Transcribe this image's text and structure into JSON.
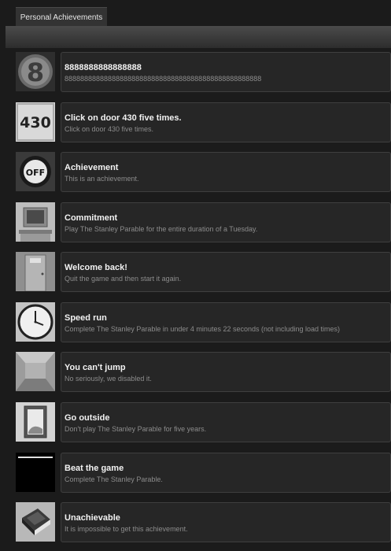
{
  "tab": {
    "label": "Personal Achievements"
  },
  "achievements": [
    {
      "icon": "number-eight-icon",
      "title": "8888888888888888",
      "description": "88888888888888888888888888888888888888888888888888"
    },
    {
      "icon": "door-430-icon",
      "title": "Click on door 430 five times.",
      "description": "Click on door 430 five times."
    },
    {
      "icon": "off-button-icon",
      "title": "Achievement",
      "description": "This is an achievement."
    },
    {
      "icon": "computer-desk-icon",
      "title": "Commitment",
      "description": "Play The Stanley Parable for the entire duration of a Tuesday."
    },
    {
      "icon": "door-437-icon",
      "title": "Welcome back!",
      "description": "Quit the game and then start it again."
    },
    {
      "icon": "clock-icon",
      "title": "Speed run",
      "description": "Complete The Stanley Parable in under 4 minutes 22 seconds (not including load times)"
    },
    {
      "icon": "empty-room-icon",
      "title": "You can't jump",
      "description": "No seriously, we disabled it."
    },
    {
      "icon": "picture-frame-icon",
      "title": "Go outside",
      "description": "Don't play The Stanley Parable for five years."
    },
    {
      "icon": "black-screen-icon",
      "title": "Beat the game",
      "description": "Complete The Stanley Parable."
    },
    {
      "icon": "book-icon",
      "title": "Unachievable",
      "description": "It is impossible to get this achievement."
    }
  ]
}
